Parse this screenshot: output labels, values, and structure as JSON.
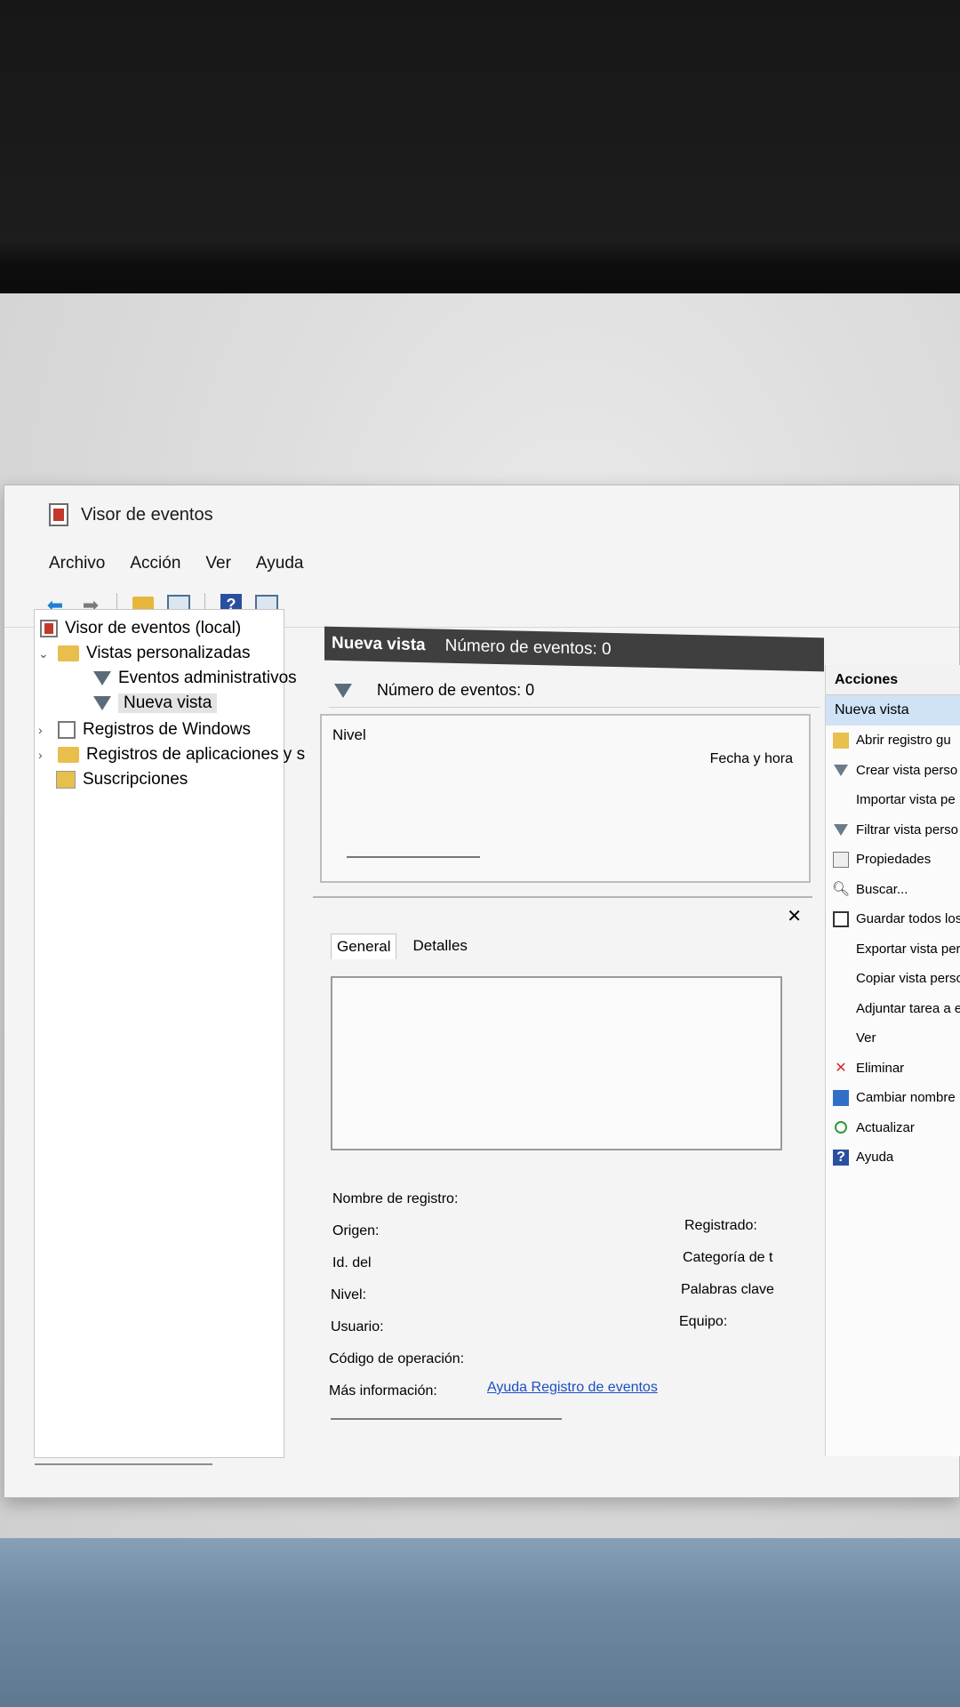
{
  "window": {
    "title": "Visor de eventos"
  },
  "menu": [
    "Archivo",
    "Acción",
    "Ver",
    "Ayuda"
  ],
  "tree": {
    "root": "Visor de eventos (local)",
    "custom_views": "Vistas personalizadas",
    "admin_events": "Eventos administrativos",
    "new_view": "Nueva vista",
    "windows_logs": "Registros de Windows",
    "app_logs": "Registros de aplicaciones y s",
    "subscriptions": "Suscripciones"
  },
  "center": {
    "header_title": "Nueva vista",
    "header_count": "Número de eventos: 0",
    "filter_count": "Número de eventos: 0",
    "col_level": "Nivel",
    "col_date": "Fecha y hora",
    "tabs": [
      "General",
      "Detalles"
    ],
    "fields": {
      "log_name": "Nombre de registro:",
      "source": "Origen:",
      "event_id": "Id. del",
      "level": "Nivel:",
      "user": "Usuario:",
      "opcode": "Código de operación:",
      "more_info": "Más información:",
      "more_info_link": "Ayuda Registro de eventos",
      "logged": "Registrado:",
      "task_category": "Categoría de t",
      "keywords": "Palabras clave",
      "computer": "Equipo:"
    }
  },
  "actions": {
    "title": "Acciones",
    "subtitle": "Nueva vista",
    "items": [
      {
        "label": "Abrir registro gu",
        "icon": "open-log-icon"
      },
      {
        "label": "Crear vista perso",
        "icon": "filter-icon"
      },
      {
        "label": "Importar vista pe",
        "icon": ""
      },
      {
        "label": "Filtrar vista perso",
        "icon": "filter-icon"
      },
      {
        "label": "Propiedades",
        "icon": "properties-icon"
      },
      {
        "label": "Buscar...",
        "icon": "find-icon"
      },
      {
        "label": "Guardar todos los",
        "icon": "save-icon"
      },
      {
        "label": "Exportar vista pers",
        "icon": ""
      },
      {
        "label": "Copiar vista person",
        "icon": ""
      },
      {
        "label": "Adjuntar tarea a est",
        "icon": ""
      },
      {
        "label": "Ver",
        "icon": ""
      },
      {
        "label": "Eliminar",
        "icon": "delete-icon"
      },
      {
        "label": "Cambiar nombre",
        "icon": "rename-icon"
      },
      {
        "label": "Actualizar",
        "icon": "refresh-icon"
      },
      {
        "label": "Ayuda",
        "icon": "help-icon"
      }
    ]
  },
  "colors": {
    "header_bg": "#3f3f3f",
    "selection": "#cfe2f6",
    "link": "#1a4fc2",
    "delete": "#d12b2b"
  }
}
